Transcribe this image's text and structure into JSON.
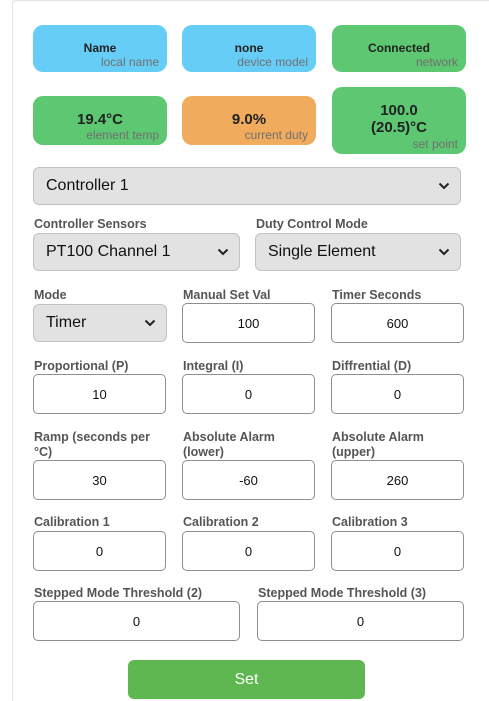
{
  "status_tiles": [
    {
      "value": "Name",
      "sub": "local name",
      "color": "#66cdf7"
    },
    {
      "value": "none",
      "sub": "device model",
      "color": "#66cdf7"
    },
    {
      "value": "Connected",
      "sub": "network",
      "color": "#5dc771"
    },
    {
      "value": "19.4°C",
      "sub": "element temp",
      "color": "#5dc771"
    },
    {
      "value": "9.0%",
      "sub": "current duty",
      "color": "#f0ac5c"
    },
    {
      "value_line1": "100.0",
      "value_line2": "(20.5)°C",
      "sub": "set point",
      "color": "#5dc771"
    }
  ],
  "controller_select": {
    "value": "Controller 1"
  },
  "controller_sensors": {
    "label": "Controller Sensors",
    "value": "PT100 Channel 1"
  },
  "duty_control_mode": {
    "label": "Duty Control Mode",
    "value": "Single Element"
  },
  "mode": {
    "label": "Mode",
    "value": "Timer"
  },
  "manual_set_val": {
    "label": "Manual Set Val",
    "value": "100"
  },
  "timer_seconds": {
    "label": "Timer Seconds",
    "value": "600"
  },
  "proportional": {
    "label": "Proportional (P)",
    "value": "10"
  },
  "integral": {
    "label": "Integral (I)",
    "value": "0"
  },
  "differential": {
    "label": "Diffrential (D)",
    "value": "0"
  },
  "ramp": {
    "label_line1": "Ramp (seconds per",
    "label_line2": "°C)",
    "value": "30"
  },
  "alarm_lower": {
    "label_line1": "Absolute Alarm",
    "label_line2": "(lower)",
    "value": "-60"
  },
  "alarm_upper": {
    "label_line1": "Absolute Alarm",
    "label_line2": "(upper)",
    "value": "260"
  },
  "calibration_1": {
    "label": "Calibration 1",
    "value": "0"
  },
  "calibration_2": {
    "label": "Calibration 2",
    "value": "0"
  },
  "calibration_3": {
    "label": "Calibration 3",
    "value": "0"
  },
  "stepped_threshold_2": {
    "label": "Stepped Mode Threshold (2)",
    "value": "0"
  },
  "stepped_threshold_3": {
    "label": "Stepped Mode Threshold (3)",
    "value": "0"
  },
  "set_button": {
    "label": "Set",
    "color": "#5fb752"
  },
  "icons": {
    "select_arrow": "chevron-down-icon"
  }
}
